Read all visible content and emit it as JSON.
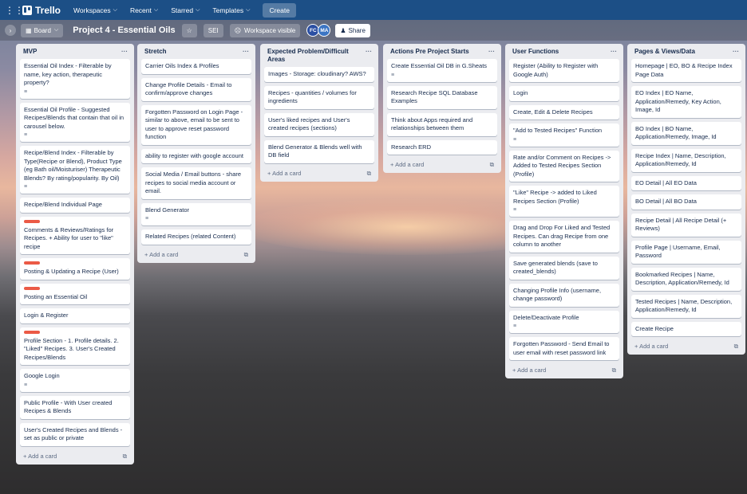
{
  "topbar": {
    "apps_icon": "apps-grid-icon",
    "logo": "Trello",
    "menus": [
      "Workspaces",
      "Recent",
      "Starred",
      "Templates"
    ],
    "create": "Create"
  },
  "boardbar": {
    "view": "Board",
    "title": "Project 4 - Essential Oils",
    "workspace": "SEI",
    "visibility": "Workspace visible",
    "avatars": [
      {
        "initials": "FC",
        "color": "#2b4fa3"
      },
      {
        "initials": "MA",
        "color": "#3b75c4"
      }
    ],
    "share": "Share"
  },
  "add_card": "Add a card",
  "lists": [
    {
      "title": "MVP",
      "cards": [
        {
          "text": "Essential Oil Index - Filterable by name, key action, therapeutic property?",
          "desc": true
        },
        {
          "text": "Essential Oil Profile - Suggested Recipes/Blends that contain that oil in carousel below.",
          "desc": true
        },
        {
          "text": "Recipe/Blend Index - Filterable by Type(Recipe or Blend), Product Type (eg Bath oil/Moisturiser) Therapeutic Blends? By rating/popularity. By Oil)",
          "desc": true
        },
        {
          "text": "Recipe/Blend Individual Page"
        },
        {
          "text": "Comments & Reviews/Ratings for Recipes. + Ability for user to \"like\" recipe",
          "label": true
        },
        {
          "text": "Posting & Updating a Recipe (User)",
          "label": true
        },
        {
          "text": "Posting an Essential Oil",
          "label": true
        },
        {
          "text": "Login & Register"
        },
        {
          "text": "Profile Section - 1. Profile details. 2. \"Liked\" Recipes. 3. User's Created Recipes/Blends",
          "label": true
        },
        {
          "text": "Google Login",
          "desc": true
        },
        {
          "text": "Public Profile - With User created Recipes & Blends"
        },
        {
          "text": "User's Created Recipes and Blends - set as public or private"
        }
      ]
    },
    {
      "title": "Stretch",
      "cards": [
        {
          "text": "Carrier Oils Index & Profiles"
        },
        {
          "text": "Change Profile Details - Email to confirm/approve changes"
        },
        {
          "text": "Forgotten Password on Login Page - similar to above, email to be sent to user to approve reset password function"
        },
        {
          "text": "ability to register with google account"
        },
        {
          "text": "Social Media / Email buttons - share recipes to social media account or email."
        },
        {
          "text": "Blend Generator",
          "desc": true
        },
        {
          "text": "Related Recipes (related Content)"
        }
      ]
    },
    {
      "title": "Expected Problem/Difficult Areas",
      "cards": [
        {
          "text": "Images - Storage: cloudinary? AWS?"
        },
        {
          "text": "Recipes - quantities / volumes for ingredients"
        },
        {
          "text": "User's liked recipes and User's created recipes (sections)"
        },
        {
          "text": "Blend Generator & Blends well with DB field"
        }
      ]
    },
    {
      "title": "Actions Pre Project Starts",
      "cards": [
        {
          "text": "Create Essential Oil DB in G.Sheats",
          "desc": true
        },
        {
          "text": "Research Recipe SQL Database Examples"
        },
        {
          "text": "Think about Apps required and relationships between them"
        },
        {
          "text": "Research ERD"
        }
      ]
    },
    {
      "title": "User Functions",
      "cards": [
        {
          "text": "Register (Ability to Register with Google Auth)"
        },
        {
          "text": "Login"
        },
        {
          "text": "Create, Edit & Delete Recipes"
        },
        {
          "text": "\"Add to Tested Recipes\" Function",
          "desc": true
        },
        {
          "text": "Rate and/or Comment on Recipes -> Added to Tested Recipes Section (Profile)"
        },
        {
          "text": "\"Like\" Recipe -> added to Liked Recipes Section (Profile)",
          "desc": true
        },
        {
          "text": "Drag and Drop For Liked and Tested Recipes. Can drag Recipe from one column to another"
        },
        {
          "text": "Save generated blends (save to created_blends)"
        },
        {
          "text": "Changing Profile Info (username, change password)"
        },
        {
          "text": "Delete/Deactivate Profile",
          "desc": true
        },
        {
          "text": "Forgotten Password - Send Email to user email with reset password link"
        }
      ]
    },
    {
      "title": "Pages & Views/Data",
      "cards": [
        {
          "text": "Homepage | EO, BO & Recipe Index Page Data"
        },
        {
          "text": "EO Index | EO Name, Application/Remedy, Key Action, Image, Id"
        },
        {
          "text": "BO Index | BO Name, Application/Remedy, Image, Id"
        },
        {
          "text": "Recipe Index | Name, Description, Application/Remedy, Id"
        },
        {
          "text": "EO Detail | All EO Data"
        },
        {
          "text": "BO Detail | All BO Data"
        },
        {
          "text": "Recipe Detail | All Recipe Detail (+ Reviews)"
        },
        {
          "text": "Profile Page | Username, Email, Password"
        },
        {
          "text": "Bookmarked Recipes | Name, Description, Application/Remedy, Id"
        },
        {
          "text": "Tested Recipes | Name, Description, Application/Remedy, Id"
        },
        {
          "text": "Create Recipe"
        }
      ]
    }
  ]
}
